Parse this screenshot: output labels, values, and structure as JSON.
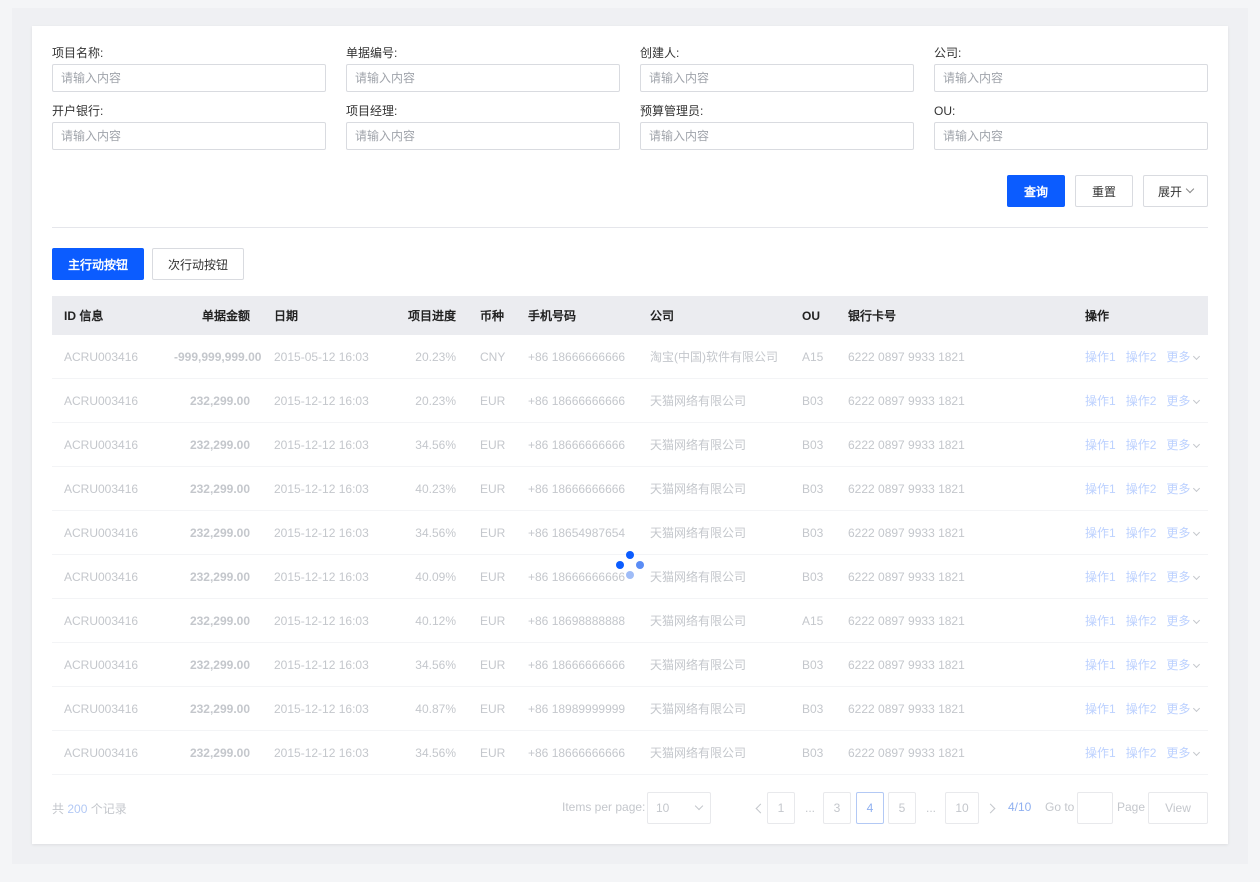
{
  "filters": {
    "row1": [
      {
        "label": "项目名称:",
        "placeholder": "请输入内容"
      },
      {
        "label": "单据编号:",
        "placeholder": "请输入内容"
      },
      {
        "label": "创建人:",
        "placeholder": "请输入内容"
      },
      {
        "label": "公司:",
        "placeholder": "请输入内容"
      }
    ],
    "row2": [
      {
        "label": "开户银行:",
        "placeholder": "请输入内容"
      },
      {
        "label": "项目经理:",
        "placeholder": "请输入内容"
      },
      {
        "label": "预算管理员:",
        "placeholder": "请输入内容"
      },
      {
        "label": "OU:",
        "placeholder": "请输入内容"
      }
    ],
    "query_label": "查询",
    "reset_label": "重置",
    "expand_label": "展开"
  },
  "toolbar": {
    "primary_label": "主行动按钮",
    "secondary_label": "次行动按钮"
  },
  "table": {
    "columns": [
      "ID 信息",
      "单据金额",
      "日期",
      "项目进度",
      "币种",
      "手机号码",
      "公司",
      "OU",
      "银行卡号",
      "操作"
    ],
    "rows": [
      [
        "ACRU003416",
        "-999,999,999.00",
        "2015-05-12 16:03",
        "20.23%",
        "CNY",
        "+86 18666666666",
        "淘宝(中国)软件有限公司",
        "A15",
        "6222 0897 9933 1821"
      ],
      [
        "ACRU003416",
        "232,299.00",
        "2015-12-12 16:03",
        "20.23%",
        "EUR",
        "+86 18666666666",
        "天猫网络有限公司",
        "B03",
        "6222 0897 9933 1821"
      ],
      [
        "ACRU003416",
        "232,299.00",
        "2015-12-12 16:03",
        "34.56%",
        "EUR",
        "+86 18666666666",
        "天猫网络有限公司",
        "B03",
        "6222 0897 9933 1821"
      ],
      [
        "ACRU003416",
        "232,299.00",
        "2015-12-12 16:03",
        "40.23%",
        "EUR",
        "+86 18666666666",
        "天猫网络有限公司",
        "B03",
        "6222 0897 9933 1821"
      ],
      [
        "ACRU003416",
        "232,299.00",
        "2015-12-12 16:03",
        "34.56%",
        "EUR",
        "+86 18654987654",
        "天猫网络有限公司",
        "B03",
        "6222 0897 9933 1821"
      ],
      [
        "ACRU003416",
        "232,299.00",
        "2015-12-12 16:03",
        "40.09%",
        "EUR",
        "+86 18666666666",
        "天猫网络有限公司",
        "B03",
        "6222 0897 9933 1821"
      ],
      [
        "ACRU003416",
        "232,299.00",
        "2015-12-12 16:03",
        "40.12%",
        "EUR",
        "+86 18698888888",
        "天猫网络有限公司",
        "A15",
        "6222 0897 9933 1821"
      ],
      [
        "ACRU003416",
        "232,299.00",
        "2015-12-12 16:03",
        "34.56%",
        "EUR",
        "+86 18666666666",
        "天猫网络有限公司",
        "B03",
        "6222 0897 9933 1821"
      ],
      [
        "ACRU003416",
        "232,299.00",
        "2015-12-12 16:03",
        "40.87%",
        "EUR",
        "+86 18989999999",
        "天猫网络有限公司",
        "B03",
        "6222 0897 9933 1821"
      ],
      [
        "ACRU003416",
        "232,299.00",
        "2015-12-12 16:03",
        "34.56%",
        "EUR",
        "+86 18666666666",
        "天猫网络有限公司",
        "B03",
        "6222 0897 9933 1821"
      ]
    ],
    "op1_label": "操作1",
    "op2_label": "操作2",
    "more_label": "更多"
  },
  "pagination": {
    "total_prefix": "共",
    "total_count": "200",
    "total_suffix": "个记录",
    "items_per_page_label": "Items per page:",
    "items_per_page_value": "10",
    "pages": [
      "1",
      "3",
      "4",
      "5",
      "10"
    ],
    "ellipsis": "...",
    "current_page": "4",
    "page_status": "4/10",
    "goto_label": "Go to",
    "page_label": "Page",
    "view_label": "View"
  },
  "colors": {
    "primary": "#0b5cff",
    "header_bg": "#ebecf0",
    "loading_dot_dark": "#0b5cff",
    "loading_dot_light": "#9fbcf7"
  },
  "state": {
    "loading": true
  }
}
